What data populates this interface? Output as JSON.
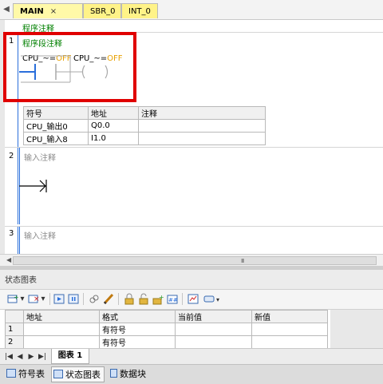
{
  "tabs": [
    {
      "label": "MAIN",
      "close": "×"
    },
    {
      "label": "SBR_0"
    },
    {
      "label": "INT_0"
    }
  ],
  "editor": {
    "program_comment": "程序注释",
    "networks": [
      {
        "number": "1",
        "comment": "程序段注释",
        "contact_label_prefix": "CPU_~=",
        "contact_label_state": "OFF",
        "coil_label_prefix": "CPU_~=",
        "coil_label_state": "OFF"
      },
      {
        "number": "2",
        "comment": "输入注释"
      },
      {
        "number": "3",
        "comment": "输入注释"
      }
    ],
    "symbol_table": {
      "headers": [
        "符号",
        "地址",
        "注释"
      ],
      "rows": [
        [
          "CPU_输出0",
          "Q0.0",
          ""
        ],
        [
          "CPU_输入8",
          "I1.0",
          ""
        ]
      ]
    },
    "scroll_grip": "III"
  },
  "status_chart": {
    "title": "状态图表",
    "headers": [
      "",
      "地址",
      "格式",
      "当前值",
      "新值"
    ],
    "rows": [
      {
        "num": "1",
        "address": "",
        "format": "有符号",
        "current": "",
        "new": ""
      },
      {
        "num": "2",
        "address": "",
        "format": "有符号",
        "current": "",
        "new": ""
      }
    ],
    "sheet_tab": "图表 1",
    "nav": [
      "|◀",
      "◀",
      "▶",
      "▶|"
    ]
  },
  "bottom_tabs": [
    {
      "label": "符号表",
      "icon": "table-icon"
    },
    {
      "label": "状态图表",
      "icon": "chart-table-icon"
    },
    {
      "label": "数据块",
      "icon": "data-block-icon"
    }
  ],
  "colors": {
    "highlight": "#e00000",
    "tab_yellow": "#fff388",
    "comment_green": "#008000",
    "off_orange": "#e8a000",
    "rail_blue": "#2a6fdb"
  }
}
